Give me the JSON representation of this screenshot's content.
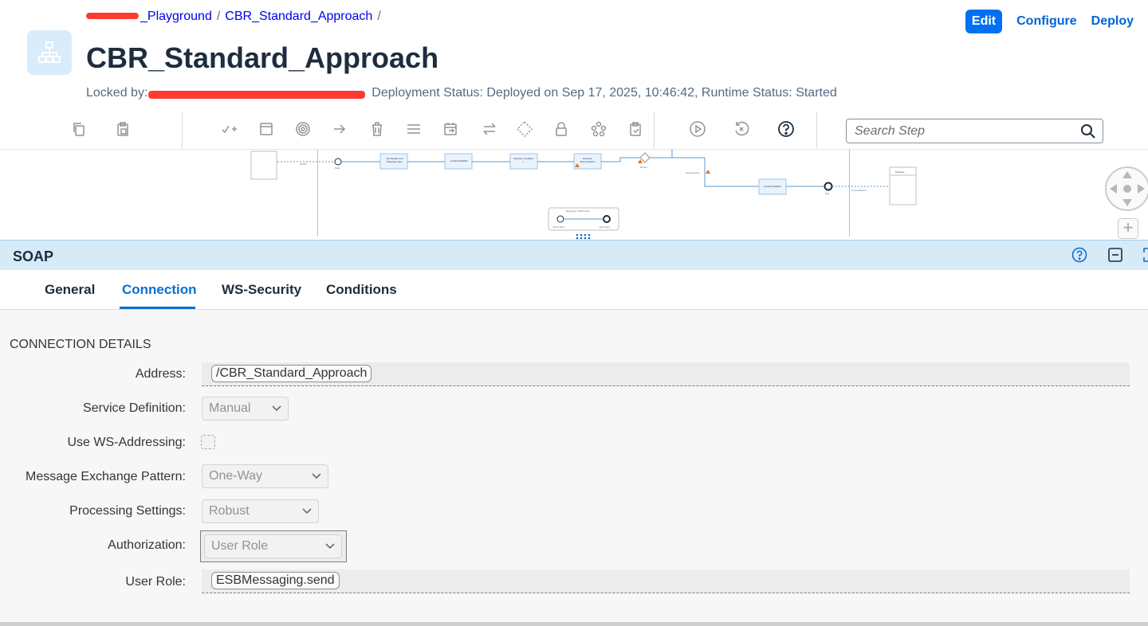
{
  "breadcrumb": {
    "items": [
      "_Playground",
      "CBR_Standard_Approach"
    ],
    "separator": "/"
  },
  "header": {
    "title": "CBR_Standard_Approach",
    "locked_by_label": "Locked by:",
    "deployment_status": "Deployment Status: Deployed on Sep 17, 2025, 10:46:42, Runtime Status: Started",
    "actions": {
      "edit": "Edit",
      "configure": "Configure",
      "deploy": "Deploy"
    }
  },
  "toolbar": {
    "search_placeholder": "Search Step",
    "icons": [
      "copy-icon",
      "paste-icon",
      "add-step-icon",
      "participant-icon",
      "event-icon",
      "connection-icon",
      "delete-icon",
      "menu-icon",
      "schedule-icon",
      "swap-icon",
      "gateway-icon",
      "lock-icon",
      "process-icon",
      "clipboard-icon",
      "simulate-icon",
      "reset-icon",
      "help-icon"
    ]
  },
  "canvas": {
    "labels": {
      "sender_arrow": "SOAP",
      "start": "Start",
      "set_header": "Set Header and Message Type",
      "content_modifier_1": "Content Modifier",
      "receiver_condition": "Receiver Condition +...",
      "receiver_determination": "Receiver Determination",
      "router": "Router",
      "actual_route": "Actual Route",
      "content_modifier_2": "Content Modifier",
      "end": "End",
      "process_direct": "ProcessDirect",
      "receiver": "Process...",
      "exception_subprocess": "Exception SubProcess",
      "error_start": "Error Start",
      "error_end": "Error End"
    }
  },
  "panel": {
    "title": "SOAP",
    "tabs": [
      "General",
      "Connection",
      "WS-Security",
      "Conditions"
    ],
    "active_tab": "Connection",
    "section_title": "CONNECTION DETAILS",
    "fields": {
      "address": {
        "label": "Address:",
        "value": "/CBR_Standard_Approach"
      },
      "service_definition": {
        "label": "Service Definition:",
        "value": "Manual"
      },
      "ws_addressing": {
        "label": "Use WS-Addressing:",
        "checked": false
      },
      "message_exchange_pattern": {
        "label": "Message Exchange Pattern:",
        "value": "One-Way"
      },
      "processing_settings": {
        "label": "Processing Settings:",
        "value": "Robust"
      },
      "authorization": {
        "label": "Authorization:",
        "value": "User Role"
      },
      "user_role": {
        "label": "User Role:",
        "value": "ESBMessaging.send"
      }
    }
  },
  "colors": {
    "accent": "#0a6ed1",
    "edit_button": "#0070f2",
    "panel_header": "#d6eaf8",
    "redaction": "#ff3b30"
  }
}
